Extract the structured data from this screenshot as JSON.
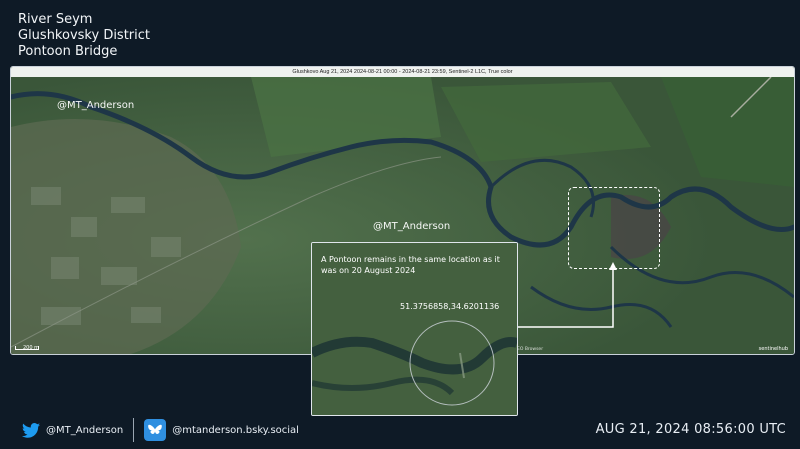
{
  "title": {
    "line1": "River Seym",
    "line2": "Glushkovsky District",
    "line3": "Pontoon Bridge"
  },
  "map": {
    "header": "Glushkovo Aug 21, 2024 2024-08-21 00:00 - 2024-08-21 23:59, Sentinel-2 L1C, True color",
    "watermark_1": "@MT_Anderson",
    "watermark_2": "@MT_Anderson",
    "scale_label": "200 m",
    "attribution": "EO Browser",
    "provider_logo": "sentinelhub"
  },
  "inset": {
    "note": "A Pontoon remains in the same location as it was on 20 August 2024",
    "coordinates": "51.3756858,34.6201136"
  },
  "footer": {
    "twitter_handle": "@MT_Anderson",
    "bsky_handle": "@mtanderson.bsky.social",
    "timestamp": "AUG 21, 2024 08:56:00 UTC"
  },
  "colors": {
    "background": "#0e1a26",
    "river": "#1e3647",
    "vegetation": "#3d5a3c",
    "accent": "#ffffff"
  }
}
